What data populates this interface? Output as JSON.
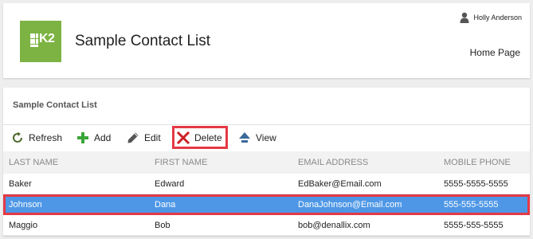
{
  "header": {
    "app_title": "Sample Contact List",
    "user_name": "Holly Anderson",
    "home_link": "Home Page",
    "logo_text": "K2"
  },
  "panel": {
    "title": "Sample Contact List"
  },
  "toolbar": {
    "refresh_label": "Refresh",
    "add_label": "Add",
    "edit_label": "Edit",
    "delete_label": "Delete",
    "view_label": "View"
  },
  "table": {
    "columns": [
      "LAST NAME",
      "FIRST NAME",
      "EMAIL ADDRESS",
      "MOBILE PHONE"
    ],
    "rows": [
      {
        "last": "Baker",
        "first": "Edward",
        "email": "EdBaker@Email.com",
        "phone": "5555-5555-5555"
      },
      {
        "last": "Johnson",
        "first": "Dana",
        "email": "DanaJohnson@Email.com",
        "phone": "555-555-5555"
      },
      {
        "last": "Maggio",
        "first": "Bob",
        "email": "bob@denallix.com",
        "phone": "5555-555-5555"
      }
    ],
    "selected_index": 1
  },
  "colors": {
    "brand": "#7cb342",
    "selection": "#4e97e6",
    "highlight": "#e53945"
  }
}
